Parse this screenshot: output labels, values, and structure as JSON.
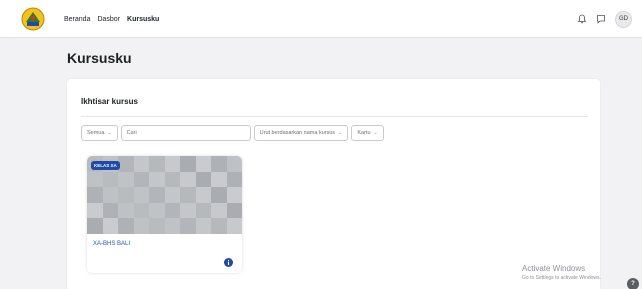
{
  "nav": {
    "items": [
      {
        "label": "Beranda",
        "active": false
      },
      {
        "label": "Dasbor",
        "active": false
      },
      {
        "label": "Kursusku",
        "active": true
      }
    ]
  },
  "header": {
    "icons": [
      "bell-icon",
      "chat-icon"
    ],
    "avatar_initials": "GD"
  },
  "page": {
    "title": "Kursusku"
  },
  "overview": {
    "title": "Ikhtisar kursus",
    "filters": {
      "grouping": "Semua",
      "search_placeholder": "Cari",
      "sort": "Urut berdasarkan nama kursus",
      "view": "Kartu"
    }
  },
  "courses": [
    {
      "badge": "KELAS XA",
      "name": "XA-BHS BALI",
      "image_tones": [
        "#b9bcbf",
        "#c4c6c9",
        "#a9acb0",
        "#bfc2c5",
        "#b2b5b9",
        "#c7c9cc",
        "#aeb1b5",
        "#c0c3c6",
        "#b6b9bc",
        "#c9cbce"
      ]
    }
  ],
  "watermark": {
    "line1": "Activate Windows",
    "line2": "Go to Settings to activate Windows."
  },
  "help_label": "?",
  "colors": {
    "accent": "#1f4aa8",
    "link": "#1a56c4",
    "background": "#f2f2f4"
  }
}
